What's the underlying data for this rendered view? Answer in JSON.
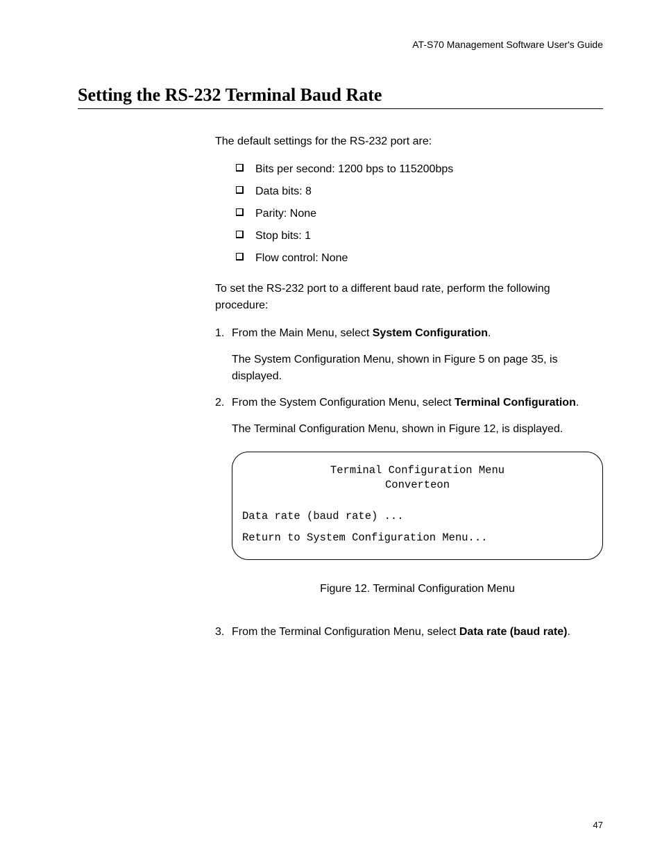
{
  "header": "AT-S70 Management Software User's Guide",
  "title": "Setting the RS-232 Terminal Baud Rate",
  "intro": "The default settings for the RS-232 port are:",
  "bullets": [
    "Bits per second: 1200 bps to 115200bps",
    "Data bits: 8",
    "Parity: None",
    "Stop bits: 1",
    "Flow control: None"
  ],
  "pre_list": "To set the RS-232 port to a different baud rate, perform the following procedure:",
  "steps": [
    {
      "num": "1.",
      "text_pre": "From the Main Menu, select ",
      "text_bold": "System Configuration",
      "text_post": ".",
      "follow": "The System Configuration Menu, shown in Figure 5 on page 35, is displayed."
    },
    {
      "num": "2.",
      "text_pre": "From the System Configuration Menu, select ",
      "text_bold": "Terminal Configuration",
      "text_post": ".",
      "follow": "The Terminal Configuration Menu, shown in Figure 12, is displayed."
    },
    {
      "num": "3.",
      "text_pre": "From the Terminal Configuration Menu, select ",
      "text_bold": "Data rate (baud rate)",
      "text_post": "."
    }
  ],
  "menu": {
    "title": "Terminal Configuration Menu",
    "subtitle": "Converteon",
    "line1": "Data rate (baud rate) ...",
    "line2": "Return to System Configuration Menu..."
  },
  "figure_caption": "Figure 12. Terminal Configuration Menu",
  "page_number": "47"
}
